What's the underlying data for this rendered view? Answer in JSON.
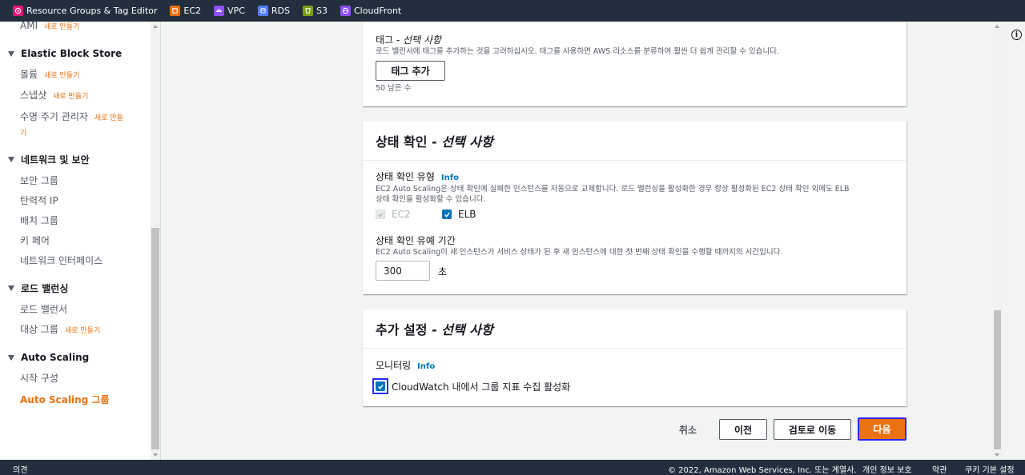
{
  "favorites": [
    {
      "label": "Resource Groups & Tag Editor",
      "color": "#e7157b",
      "icon": "resource-groups-icon"
    },
    {
      "label": "EC2",
      "color": "#ed7100",
      "icon": "ec2-icon"
    },
    {
      "label": "VPC",
      "color": "#8c4fff",
      "icon": "vpc-icon"
    },
    {
      "label": "RDS",
      "color": "#527fff",
      "icon": "rds-icon"
    },
    {
      "label": "S3",
      "color": "#7aa116",
      "icon": "s3-icon"
    },
    {
      "label": "CloudFront",
      "color": "#8c4fff",
      "icon": "cloudfront-icon"
    }
  ],
  "sidebar": {
    "new_badge": "새로 만들기",
    "ami": "AMI",
    "sections": {
      "ebs": "Elastic Block Store",
      "network": "네트워크 및 보안",
      "lb": "로드 밸런싱",
      "asg": "Auto Scaling"
    },
    "items": {
      "volumes": "볼륨",
      "snapshots": "스냅샷",
      "lifecycle": "수명 주기 관리자",
      "lifecycle_new_1": "새로 만들",
      "lifecycle_new_2": "기",
      "security_groups": "보안 그룹",
      "elastic_ips": "탄력적 IP",
      "placement_groups": "배치 그룹",
      "key_pairs": "키 페어",
      "network_interfaces": "네트워크 인터페이스",
      "load_balancers": "로드 밸런서",
      "target_groups": "대상 그룹",
      "launch_configs": "시작 구성",
      "asg_groups": "Auto Scaling 그룹"
    }
  },
  "tags": {
    "label": "태그 - ",
    "optional": "선택 사항",
    "description": "로드 밸런서에 태그를 추가하는 것을 고려하십시오. 태그를 사용하면 AWS 리소스를 분류하여 훨씬 더 쉽게 관리할 수 있습니다.",
    "add_button": "태그 추가",
    "remaining": "50 남은 수"
  },
  "health_check": {
    "title": "상태 확인 - ",
    "optional": "선택 사항",
    "type_label": "상태 확인 유형",
    "info": "Info",
    "type_description_1": "EC2 Auto Scaling은 상태 확인에 실패한 인스턴스를 자동으로 교체합니다. 로드 밸런싱을 활성화한 경우 항상 활성화된 EC2 상태 확인 외에도 ELB",
    "type_description_2": "상태 확인을 활성화할 수 있습니다.",
    "ec2_label": "EC2",
    "ec2_checked": true,
    "elb_label": "ELB",
    "elb_checked": true,
    "grace_label": "상태 확인 유예 기간",
    "grace_description": "EC2 Auto Scaling이 새 인스턴스가 서비스 상태가 된 후 새 인스턴스에 대한 첫 번째 상태 확인을 수행할 때까지의 시간입니다.",
    "grace_value": "300",
    "grace_unit": "초"
  },
  "additional": {
    "title": "추가 설정 - ",
    "optional": "선택 사항",
    "monitoring_label": "모니터링",
    "info": "Info",
    "cloudwatch_label": "CloudWatch 내에서 그룹 지표 수집 활성화",
    "cloudwatch_checked": true
  },
  "actions": {
    "cancel": "취소",
    "previous": "이전",
    "review": "검토로 이동",
    "next": "다음"
  },
  "footer": {
    "feedback": "의견",
    "copyright": "© 2022, Amazon Web Services, Inc. 또는 계열사.",
    "privacy": "개인 정보 보호",
    "terms": "약관",
    "cookies": "쿠키 기본 설정"
  },
  "colors": {
    "accent": "#ec7211",
    "link": "#0073bb",
    "navy": "#232f3e",
    "checkbox": "#0073bb"
  }
}
